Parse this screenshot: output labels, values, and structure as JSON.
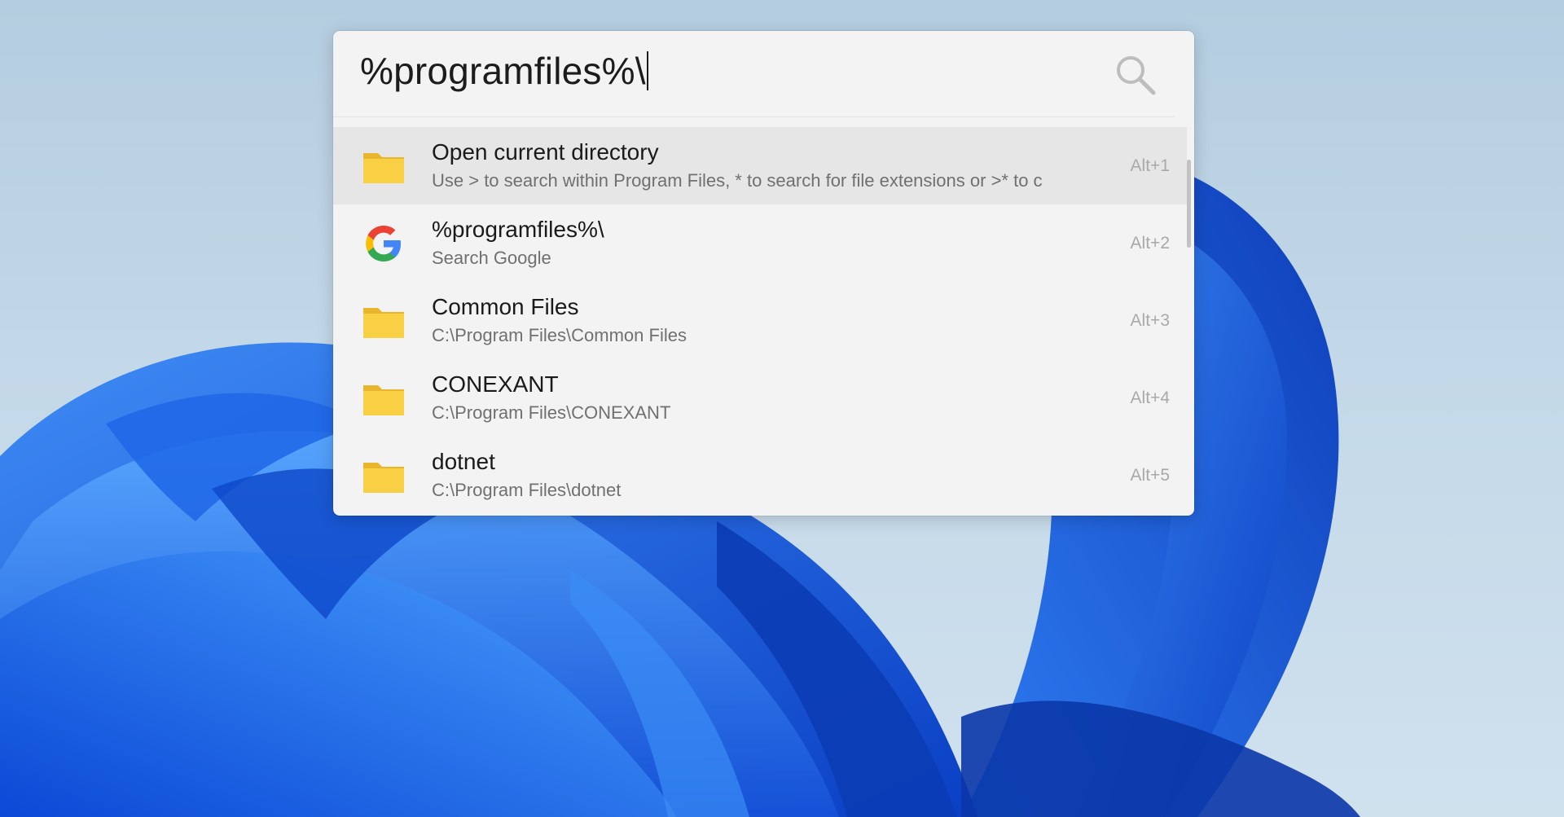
{
  "launcher": {
    "query": "%programfiles%\\",
    "results": [
      {
        "icon": "folder-icon",
        "title": "Open current directory",
        "subtitle": "Use > to search within Program Files, * to search for file extensions or >* to c",
        "hotkey": "Alt+1",
        "selected": true
      },
      {
        "icon": "google-icon",
        "title": "%programfiles%\\",
        "subtitle": "Search Google",
        "hotkey": "Alt+2",
        "selected": false
      },
      {
        "icon": "folder-icon",
        "title": "Common Files",
        "subtitle": "C:\\Program Files\\Common Files",
        "hotkey": "Alt+3",
        "selected": false
      },
      {
        "icon": "folder-icon",
        "title": "CONEXANT",
        "subtitle": "C:\\Program Files\\CONEXANT",
        "hotkey": "Alt+4",
        "selected": false
      },
      {
        "icon": "folder-icon",
        "title": "dotnet",
        "subtitle": "C:\\Program Files\\dotnet",
        "hotkey": "Alt+5",
        "selected": false
      }
    ]
  },
  "colors": {
    "panel_background": "#f3f3f3",
    "selected_row": "#e6e6e6",
    "folder_yellow": "#f9cf43",
    "wallpaper_blue": "#1a5fe0"
  }
}
